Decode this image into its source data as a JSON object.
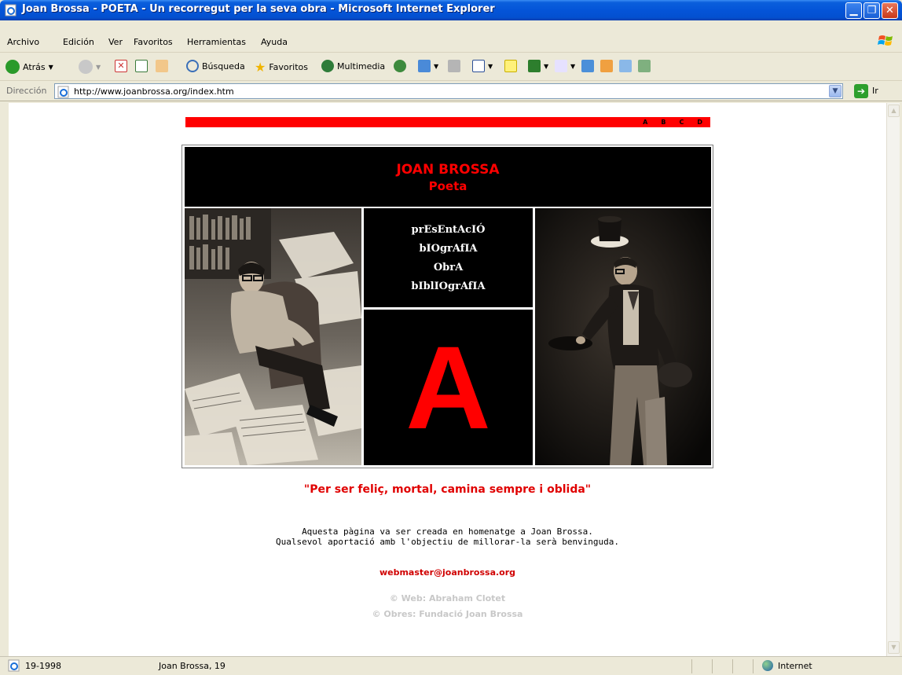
{
  "window": {
    "title": "Joan Brossa - POETA - Un recorregut per la seva obra - Microsoft Internet Explorer",
    "min_glyph": "▁",
    "max_glyph": "❐",
    "close_glyph": "✕"
  },
  "menu": [
    "Archivo",
    "Edición",
    "Ver",
    "Favoritos",
    "Herramientas",
    "Ayuda"
  ],
  "toolbar": {
    "back": "Atrás",
    "search": "Búsqueda",
    "favorites": "Favoritos",
    "multimedia": "Multimedia"
  },
  "address": {
    "label": "Dirección",
    "url": "http://www.joanbrossa.org/index.htm",
    "go": "Ir"
  },
  "page": {
    "top_letters": [
      "A",
      "B",
      "C",
      "D"
    ],
    "name": "JOAN BROSSA",
    "subtitle": "Poeta",
    "nav": [
      "prEsEntAcIÓ",
      "bIOgrAfIA",
      "ObrA",
      "bIblIOgrAfIA"
    ],
    "big_letter": "A",
    "quote": "\"Per ser feliç, mortal, camina sempre i oblida\"",
    "note_line1": "Aquesta pàgina va ser creada en homenatge a Joan Brossa.",
    "note_line2": "Qualsevol aportació amb l'objectiu de millorar-la serà benvinguda.",
    "email": "webmaster@joanbrossa.org",
    "credit_web": "© Web: Abraham Clotet",
    "credit_works": "© Obres: Fundació Joan Brossa"
  },
  "status": {
    "left": "19-1998",
    "middle": "Joan Brossa, 19",
    "zone": "Internet"
  },
  "colors": {
    "accent": "#ff0000",
    "xp_blue": "#0454d8"
  }
}
